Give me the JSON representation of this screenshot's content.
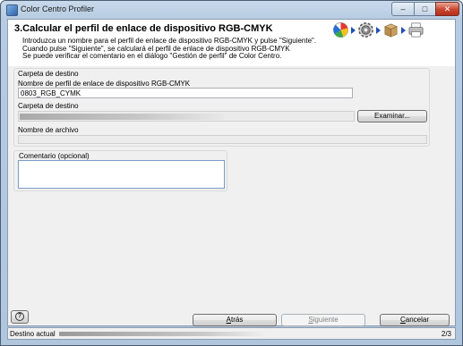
{
  "window": {
    "title": "Color Centro Profiler",
    "controls": {
      "minimize": "‒",
      "maximize": "□",
      "close": "✕"
    }
  },
  "header": {
    "step_title": "3.Calcular el perfil de enlace de dispositivo RGB-CMYK",
    "intro_lines": [
      "Introduzca un nombre para el perfil de enlace de dispositivo RGB-CMYK   y pulse \"Siguiente\".",
      "Cuando pulse \"Siguiente\", se calculará el perfil de enlace de dispositivo RGB-CMYK",
      "Se puede verificar el comentario en el diálogo \"Gestión de perfil\" de Color Centro."
    ],
    "step_icons": [
      "color-palette-icon",
      "gear-icon",
      "box-icon",
      "printer-icon"
    ],
    "arrow_color": "#1f4fb3"
  },
  "destination": {
    "section_label": "Carpeta de destino",
    "profile_name_label": "Nombre de perfil de enlace de dispositivo RGB-CMYK",
    "profile_name_value": "0803_RGB_CYMK",
    "folder_label": "Carpeta de destino",
    "browse_button": "Examinar...",
    "file_name_label": "Nombre de archivo",
    "file_name_value": ""
  },
  "comment": {
    "label": "Comentario (opcional)",
    "value": ""
  },
  "footer": {
    "help_glyph": "?",
    "back_button": {
      "key": "A",
      "rest": "trás"
    },
    "next_button": {
      "key": "S",
      "rest": "iguiente"
    },
    "cancel_button": {
      "key": "C",
      "rest": "ancelar"
    }
  },
  "status": {
    "label": "Destino actual",
    "page": "2/3"
  }
}
